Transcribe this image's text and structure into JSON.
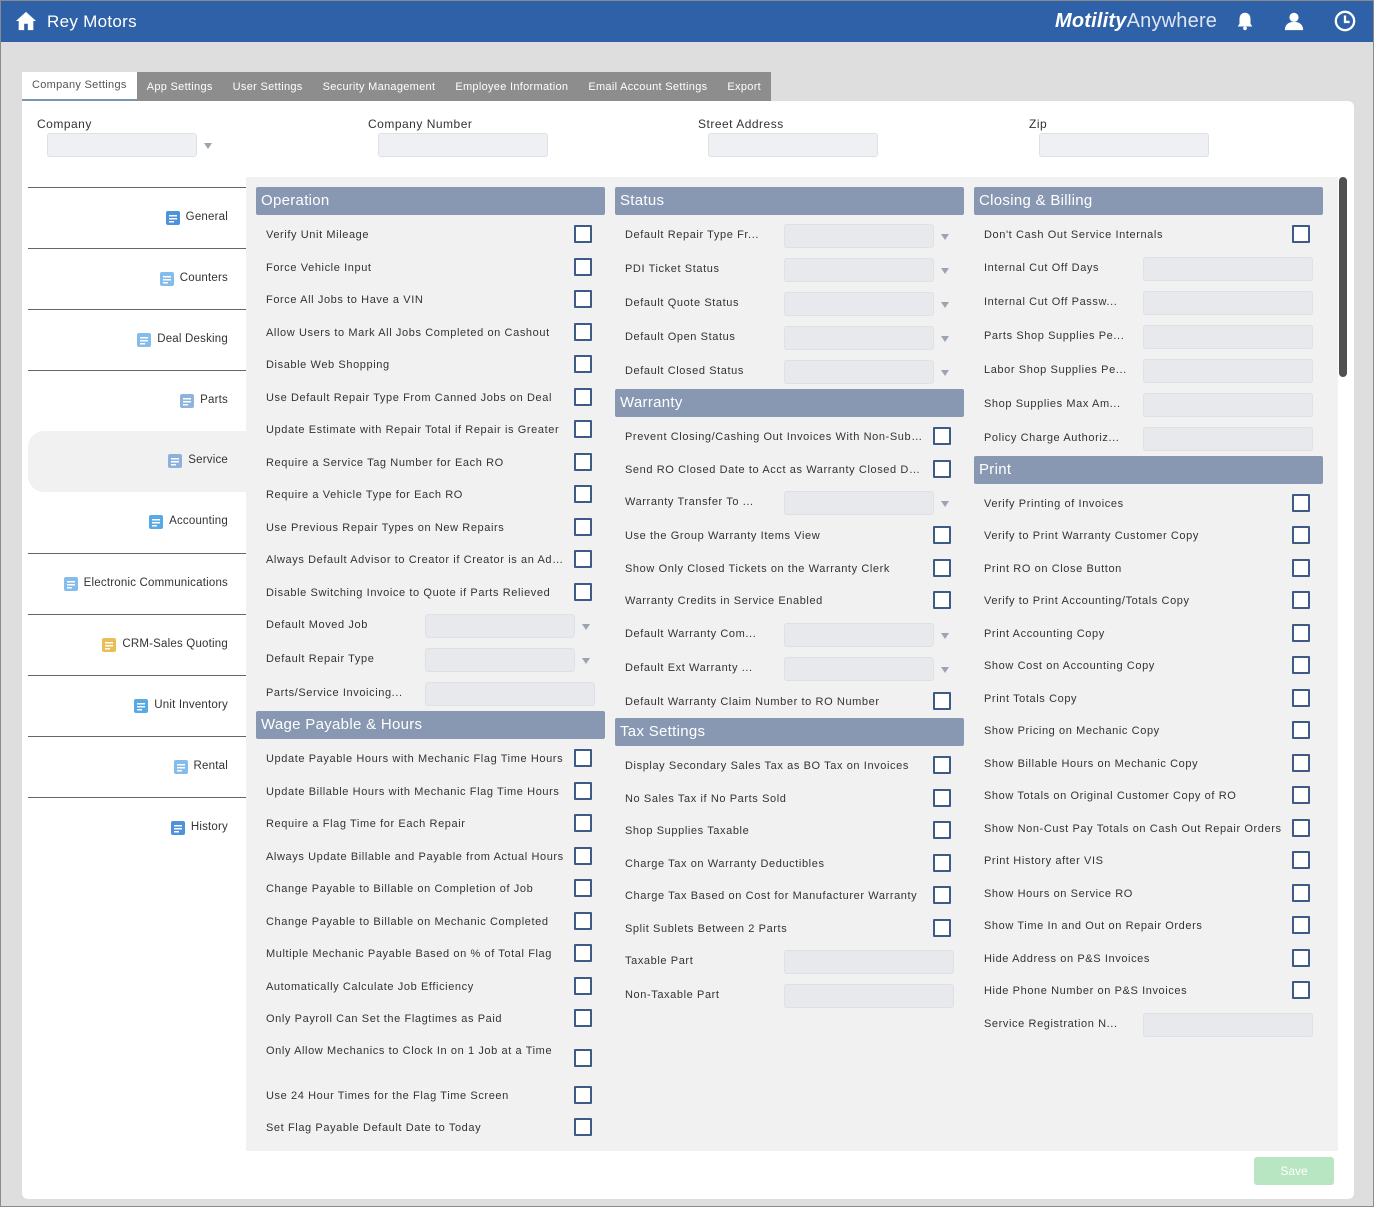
{
  "app": {
    "title": "Rey Motors",
    "brand_bold": "Motility",
    "brand_rest": "Anywhere"
  },
  "tabs": [
    {
      "label": "Company Settings"
    },
    {
      "label": "App Settings"
    },
    {
      "label": "User Settings"
    },
    {
      "label": "Security Management"
    },
    {
      "label": "Employee Information"
    },
    {
      "label": "Email Account Settings"
    },
    {
      "label": "Export"
    }
  ],
  "header": {
    "company": "Company",
    "company_number": "Company Number",
    "street_address": "Street Address",
    "zip": "Zip"
  },
  "sidebar": [
    {
      "label": "General"
    },
    {
      "label": "Counters"
    },
    {
      "label": "Deal Desking"
    },
    {
      "label": "Parts"
    },
    {
      "label": "Service"
    },
    {
      "label": "Accounting"
    },
    {
      "label": "Electronic Communications"
    },
    {
      "label": "CRM-Sales Quoting"
    },
    {
      "label": "Unit Inventory"
    },
    {
      "label": "Rental"
    },
    {
      "label": "History"
    }
  ],
  "col1": {
    "operation_title": "Operation",
    "operation": [
      {
        "label": "Verify Unit Mileage",
        "type": "cb"
      },
      {
        "label": "Force Vehicle Input",
        "type": "cb"
      },
      {
        "label": "Force All Jobs to Have a VIN",
        "type": "cb"
      },
      {
        "label": "Allow Users to Mark All Jobs Completed on Cashout",
        "type": "cb"
      },
      {
        "label": "Disable Web Shopping",
        "type": "cb"
      },
      {
        "label": "Use Default Repair Type From Canned Jobs on Deal",
        "type": "cb"
      },
      {
        "label": "Update Estimate with Repair Total if Repair is Greater",
        "type": "cb"
      },
      {
        "label": "Require a Service Tag Number for Each RO",
        "type": "cb"
      },
      {
        "label": "Require a Vehicle Type for Each RO",
        "type": "cb"
      },
      {
        "label": "Use Previous Repair Types on New Repairs",
        "type": "cb"
      },
      {
        "label": "Always Default Advisor to Creator if Creator is an Advisor",
        "type": "cb"
      },
      {
        "label": "Disable Switching Invoice to Quote if Parts Relieved",
        "type": "cb"
      },
      {
        "label": "Default Moved Job",
        "type": "sel"
      },
      {
        "label": "Default Repair Type",
        "type": "sel"
      },
      {
        "label": "Parts/Service Invoicing...",
        "type": "txt"
      }
    ],
    "wage_title": "Wage Payable & Hours",
    "wage": [
      {
        "label": "Update Payable Hours with Mechanic Flag Time Hours",
        "type": "cb"
      },
      {
        "label": "Update Billable Hours with Mechanic Flag Time Hours",
        "type": "cb"
      },
      {
        "label": "Require a Flag Time for Each Repair",
        "type": "cb"
      },
      {
        "label": "Always Update Billable and Payable from Actual Hours",
        "type": "cb"
      },
      {
        "label": "Change Payable to Billable on Completion of Job",
        "type": "cb"
      },
      {
        "label": "Change Payable to Billable on Mechanic Completed",
        "type": "cb"
      },
      {
        "label": "Multiple Mechanic Payable Based on % of Total Flag",
        "type": "cb"
      },
      {
        "label": "Automatically Calculate Job Efficiency",
        "type": "cb"
      },
      {
        "label": "Only Payroll Can Set the Flagtimes as Paid",
        "type": "cb"
      },
      {
        "label": "Only Allow Mechanics to Clock In on 1 Job at a Time",
        "type": "cb",
        "tall": true
      },
      {
        "label": "Use 24 Hour Times for the Flag Time Screen",
        "type": "cb"
      },
      {
        "label": "Set Flag Payable Default Date to Today",
        "type": "cb"
      }
    ]
  },
  "col2": {
    "status_title": "Status",
    "status": [
      {
        "label": "Default Repair Type Fr...",
        "type": "sel"
      },
      {
        "label": "PDI Ticket Status",
        "type": "sel"
      },
      {
        "label": "Default Quote Status",
        "type": "sel"
      },
      {
        "label": "Default Open Status",
        "type": "sel"
      },
      {
        "label": "Default Closed Status",
        "type": "sel"
      }
    ],
    "warranty_title": "Warranty",
    "warranty": [
      {
        "label": "Prevent Closing/Cashing Out Invoices With Non-Submitted",
        "type": "cb"
      },
      {
        "label": "Send RO Closed Date to Acct as Warranty Closed Date",
        "type": "cb"
      },
      {
        "label": "Warranty Transfer To ...",
        "type": "sel"
      },
      {
        "label": "Use the Group Warranty Items View",
        "type": "cb"
      },
      {
        "label": "Show Only Closed Tickets on the Warranty Clerk",
        "type": "cb"
      },
      {
        "label": "Warranty Credits in Service Enabled",
        "type": "cb"
      },
      {
        "label": "Default Warranty Com...",
        "type": "sel"
      },
      {
        "label": "Default Ext Warranty ...",
        "type": "sel"
      },
      {
        "label": "Default Warranty Claim Number to RO Number",
        "type": "cb"
      }
    ],
    "tax_title": "Tax Settings",
    "tax": [
      {
        "label": "Display Secondary Sales Tax as BO Tax on Invoices",
        "type": "cb"
      },
      {
        "label": "No Sales Tax if No Parts Sold",
        "type": "cb"
      },
      {
        "label": "Shop Supplies Taxable",
        "type": "cb"
      },
      {
        "label": "Charge Tax on Warranty Deductibles",
        "type": "cb"
      },
      {
        "label": "Charge Tax Based on Cost for Manufacturer Warranty",
        "type": "cb"
      },
      {
        "label": "Split Sublets Between 2 Parts",
        "type": "cb"
      },
      {
        "label": "Taxable Part",
        "type": "txt"
      },
      {
        "label": "Non-Taxable Part",
        "type": "txt"
      }
    ]
  },
  "col3": {
    "closing_title": "Closing & Billing",
    "closing": [
      {
        "label": "Don't Cash Out Service Internals",
        "type": "cb"
      },
      {
        "label": "Internal Cut Off Days",
        "type": "txt"
      },
      {
        "label": "Internal Cut Off Passw...",
        "type": "txt"
      },
      {
        "label": "Parts Shop Supplies Pe...",
        "type": "txt"
      },
      {
        "label": "Labor Shop Supplies Pe...",
        "type": "txt"
      },
      {
        "label": "Shop Supplies Max Am...",
        "type": "txt"
      },
      {
        "label": "Policy Charge Authoriz...",
        "type": "txt"
      }
    ],
    "print_title": "Print",
    "print": [
      {
        "label": "Verify Printing of Invoices",
        "type": "cb"
      },
      {
        "label": "Verify to Print Warranty Customer Copy",
        "type": "cb"
      },
      {
        "label": "Print RO on Close Button",
        "type": "cb"
      },
      {
        "label": "Verify to Print Accounting/Totals Copy",
        "type": "cb"
      },
      {
        "label": "Print Accounting Copy",
        "type": "cb"
      },
      {
        "label": "Show Cost on Accounting Copy",
        "type": "cb"
      },
      {
        "label": "Print Totals Copy",
        "type": "cb"
      },
      {
        "label": "Show Pricing on Mechanic Copy",
        "type": "cb"
      },
      {
        "label": "Show Billable Hours on Mechanic Copy",
        "type": "cb"
      },
      {
        "label": "Show Totals on Original Customer Copy of RO",
        "type": "cb"
      },
      {
        "label": "Show Non-Cust Pay Totals on Cash Out Repair Orders",
        "type": "cb"
      },
      {
        "label": "Print History after VIS",
        "type": "cb"
      },
      {
        "label": "Show Hours on Service RO",
        "type": "cb"
      },
      {
        "label": "Show Time In and Out on Repair Orders",
        "type": "cb"
      },
      {
        "label": "Hide Address on P&S Invoices",
        "type": "cb"
      },
      {
        "label": "Hide Phone Number on P&S Invoices",
        "type": "cb"
      },
      {
        "label": "Service Registration N...",
        "type": "txt"
      }
    ]
  },
  "save_label": "Save",
  "colors": {
    "topbar": "#2f61a8",
    "section": "#8898b2",
    "checkbox": "#3e5a86",
    "save": "#b8e6c2"
  }
}
